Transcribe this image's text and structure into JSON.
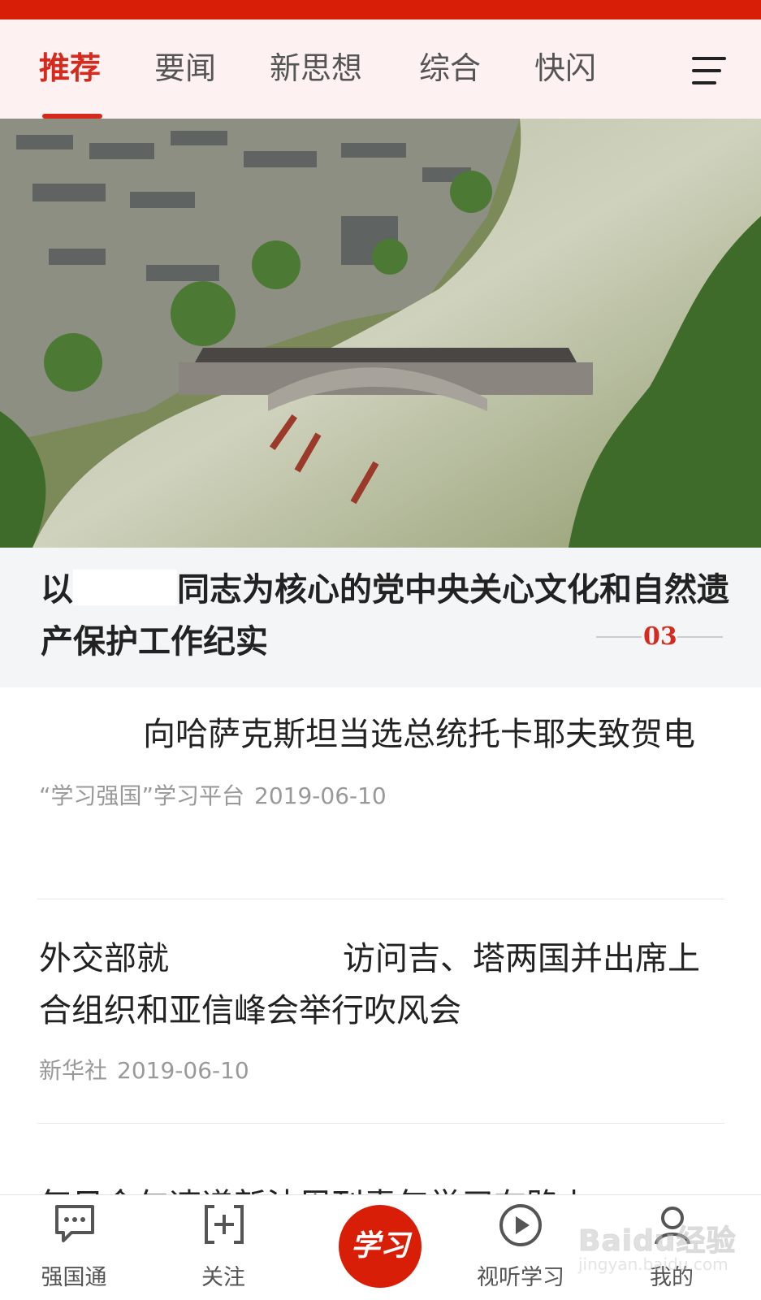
{
  "colors": {
    "brand_red": "#d81e06",
    "active_tab": "#d62a1e",
    "tab_bar_bg": "#fdf2f1",
    "caption_bg": "#f4f5f7",
    "meta_text": "#999999"
  },
  "tabs": [
    {
      "label": "推荐",
      "active": true
    },
    {
      "label": "要闻",
      "active": false
    },
    {
      "label": "新思想",
      "active": false
    },
    {
      "label": "综合",
      "active": false
    },
    {
      "label": "快闪",
      "active": false
    }
  ],
  "menu_icon": "hamburger-menu-icon",
  "hero": {
    "image": "aerial photo of an ancient water town with a covered arch bridge and dragon boats racing on the river",
    "title_part1": "以",
    "title_part2": "同志为核心的党中央关心文化和自然遗产保护工作纪实",
    "page_indicator": "03"
  },
  "articles": [
    {
      "title_before_redact": "",
      "title_after_redact": "向哈萨克斯坦当选总统托卡耶夫致贺电",
      "source": "“学习强国”学习平台",
      "date": "2019-06-10"
    },
    {
      "title_before_redact": "外交部就",
      "title_after_redact": "访问吉、塔两国并出席上合组织和亚信峰会举行吹风会",
      "source": "新华社",
      "date": "2019-06-10"
    }
  ],
  "partial_article_title": "每日金句速递新法周刊青年学习在路上",
  "bottom_nav": [
    {
      "label": "强国通",
      "icon": "chat-bubble-icon"
    },
    {
      "label": "关注",
      "icon": "add-subscribe-icon"
    },
    {
      "label": "学习",
      "icon": "xuexi-logo-icon"
    },
    {
      "label": "视听学习",
      "icon": "play-circle-icon"
    },
    {
      "label": "我的",
      "icon": "user-icon"
    }
  ],
  "watermark": {
    "main": "Baidu经验",
    "sub": "jingyan.baidu.com"
  }
}
